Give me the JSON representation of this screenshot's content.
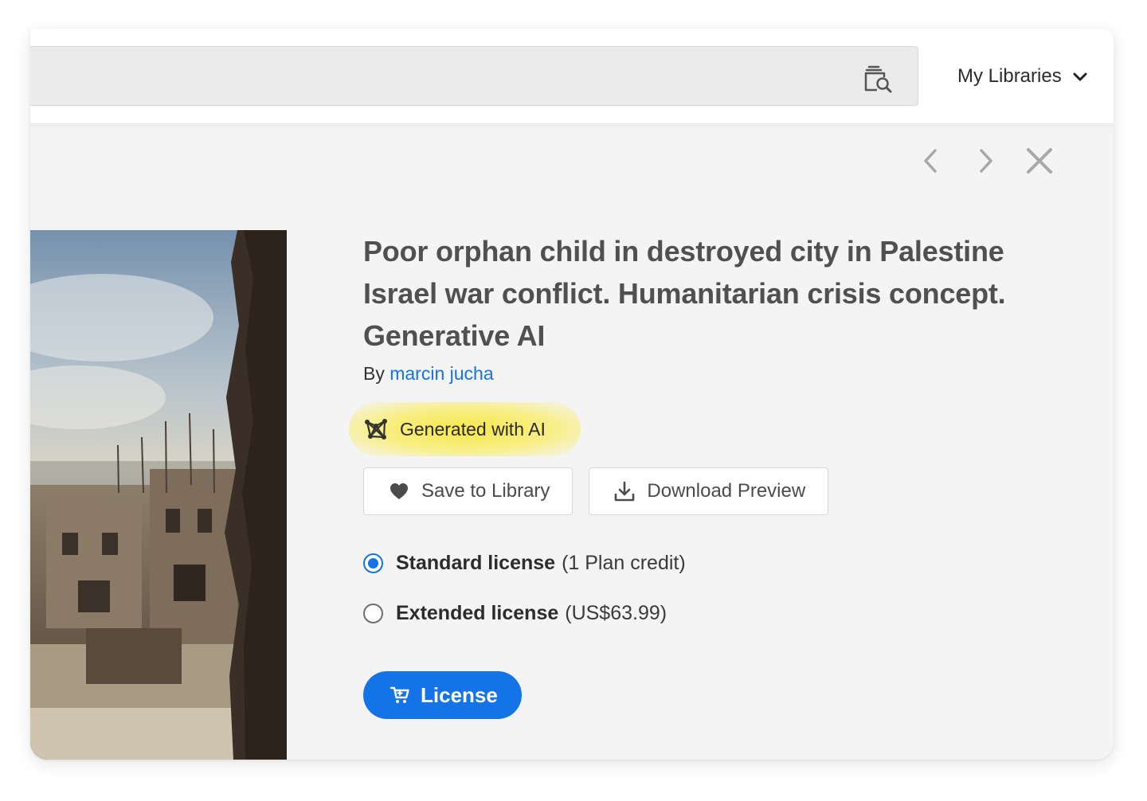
{
  "header": {
    "search": {
      "value": "",
      "placeholder": ""
    },
    "search_icon": "visual-search-icon",
    "libraries_label": "My Libraries"
  },
  "nav": {
    "prev_icon": "chevron-left-icon",
    "next_icon": "chevron-right-icon",
    "close_icon": "close-icon"
  },
  "asset": {
    "title": "Poor orphan child in destroyed city in Palestine Israel war conflict. Humanitarian crisis concept. Generative AI",
    "by_label": "By",
    "author": "marcin jucha",
    "ai_badge": "Generated with AI"
  },
  "actions": {
    "save_label": "Save to Library",
    "download_label": "Download Preview"
  },
  "licenses": [
    {
      "name": "Standard license",
      "note": "(1 Plan credit)",
      "selected": true
    },
    {
      "name": "Extended license",
      "note": "(US$63.99)",
      "selected": false
    }
  ],
  "license_button": "License",
  "colors": {
    "accent": "#1473e6",
    "highlight": "#f8e628",
    "panel_bg": "#f4f4f4"
  }
}
